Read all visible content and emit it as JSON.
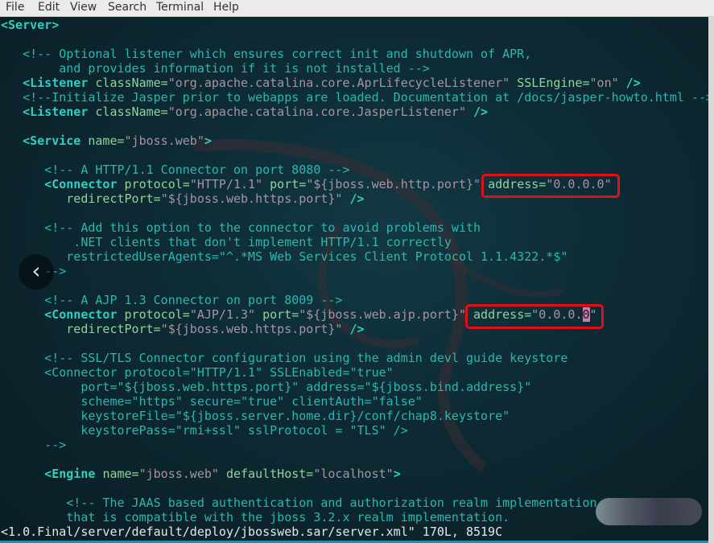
{
  "menu": [
    "File",
    "Edit",
    "View",
    "Search",
    "Terminal",
    "Help"
  ],
  "editor": {
    "lines": [
      [
        [
          "t",
          "<Server>"
        ]
      ],
      [],
      [
        [
          "c",
          "   <!-- Optional listener which ensures correct init and shutdown of APR,"
        ]
      ],
      [
        [
          "c",
          "        and provides information if it is not installed -->"
        ]
      ],
      [
        [
          "t",
          "   <Listener "
        ],
        [
          "a",
          "className="
        ],
        [
          "v",
          "\"org.apache.catalina.core.AprLifecycleListener\" "
        ],
        [
          "a",
          "SSLEngine="
        ],
        [
          "v",
          "\"on\" "
        ],
        [
          "t",
          "/>"
        ]
      ],
      [
        [
          "c",
          "   <!--Initialize Jasper prior to webapps are loaded. Documentation at /docs/jasper-howto.html -->"
        ]
      ],
      [
        [
          "t",
          "   <Listener "
        ],
        [
          "a",
          "className="
        ],
        [
          "v",
          "\"org.apache.catalina.core.JasperListener\" "
        ],
        [
          "t",
          "/>"
        ]
      ],
      [],
      [
        [
          "t",
          "   <Service "
        ],
        [
          "a",
          "name="
        ],
        [
          "v",
          "\"jboss.web\""
        ],
        [
          "t",
          ">"
        ]
      ],
      [],
      [
        [
          "c",
          "      <!-- A HTTP/1.1 Connector on port 8080 -->"
        ]
      ],
      [
        [
          "t",
          "      <Connector "
        ],
        [
          "a",
          "protocol="
        ],
        [
          "v",
          "\"HTTP/1.1\" "
        ],
        [
          "a",
          "port="
        ],
        [
          "v",
          "\"${jboss.web.http.port}\" "
        ],
        [
          "a",
          "address="
        ],
        [
          "v",
          "\"0.0.0.0\""
        ]
      ],
      [
        [
          "a",
          "         redirectPort="
        ],
        [
          "v",
          "\"${jboss.web.https.port}\" "
        ],
        [
          "t",
          "/>"
        ]
      ],
      [],
      [
        [
          "c",
          "      <!-- Add this option to the connector to avoid problems with"
        ]
      ],
      [
        [
          "c",
          "          .NET clients that don't implement HTTP/1.1 correctly"
        ]
      ],
      [
        [
          "c",
          "         restrictedUserAgents=\"^.*MS Web Services Client Protocol 1.1.4322.*$\""
        ]
      ],
      [
        [
          "c",
          "      -->"
        ]
      ],
      [],
      [
        [
          "c",
          "      <!-- A AJP 1.3 Connector on port 8009 -->"
        ]
      ],
      [
        [
          "t",
          "      <Connector "
        ],
        [
          "a",
          "protocol="
        ],
        [
          "v",
          "\"AJP/1.3\" "
        ],
        [
          "a",
          "port="
        ],
        [
          "v",
          "\"${jboss.web.ajp.port}\" "
        ],
        [
          "a",
          "address="
        ],
        [
          "v",
          "\"0.0.0."
        ],
        [
          "cur",
          "0"
        ],
        [
          "v",
          "\""
        ]
      ],
      [
        [
          "a",
          "         redirectPort="
        ],
        [
          "v",
          "\"${jboss.web.https.port}\" "
        ],
        [
          "t",
          "/>"
        ]
      ],
      [],
      [
        [
          "c",
          "      <!-- SSL/TLS Connector configuration using the admin devl guide keystore"
        ]
      ],
      [
        [
          "c",
          "      <Connector protocol=\"HTTP/1.1\" SSLEnabled=\"true\""
        ]
      ],
      [
        [
          "c",
          "           port=\"${jboss.web.https.port}\" address=\"${jboss.bind.address}\""
        ]
      ],
      [
        [
          "c",
          "           scheme=\"https\" secure=\"true\" clientAuth=\"false\""
        ]
      ],
      [
        [
          "c",
          "           keystoreFile=\"${jboss.server.home.dir}/conf/chap8.keystore\""
        ]
      ],
      [
        [
          "c",
          "           keystorePass=\"rmi+ssl\" sslProtocol = \"TLS\" />"
        ]
      ],
      [
        [
          "c",
          "      -->"
        ]
      ],
      [],
      [
        [
          "t",
          "      <Engine "
        ],
        [
          "a",
          "name="
        ],
        [
          "v",
          "\"jboss.web\" "
        ],
        [
          "a",
          "defaultHost="
        ],
        [
          "v",
          "\"localhost\""
        ],
        [
          "t",
          ">"
        ]
      ],
      [],
      [
        [
          "c",
          "         <!-- The JAAS based authentication and authorization realm implementation"
        ]
      ],
      [
        [
          "c",
          "         that is compatible with the jboss 3.2.x realm implementation."
        ]
      ]
    ],
    "status": "<1.0.Final/server/default/deploy/jbossweb.sar/server.xml\" 170L, 8519C"
  },
  "highlight_color": "#e0101a",
  "back_icon": "chevron-left-icon"
}
